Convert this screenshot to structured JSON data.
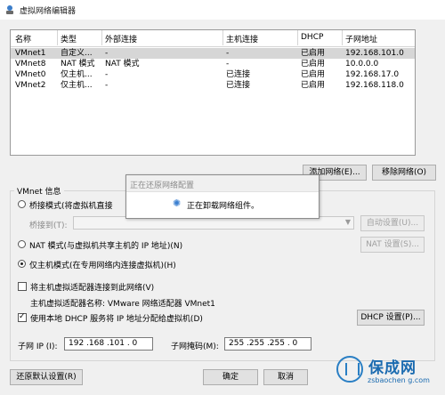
{
  "window": {
    "title": "虚拟网络编辑器",
    "icon": "vmware-network-icon"
  },
  "table": {
    "headers": [
      "名称",
      "类型",
      "外部连接",
      "主机连接",
      "DHCP",
      "子网地址"
    ],
    "rows": [
      [
        "VMnet1",
        "自定义...",
        "-",
        "-",
        "已启用",
        "192.168.101.0"
      ],
      [
        "VMnet8",
        "NAT 模式",
        "NAT 模式",
        "-",
        "已启用",
        "10.0.0.0"
      ],
      [
        "VMnet0",
        "仅主机...",
        "-",
        "已连接",
        "已启用",
        "192.168.17.0"
      ],
      [
        "VMnet2",
        "仅主机...",
        "-",
        "已连接",
        "已启用",
        "192.168.118.0"
      ]
    ],
    "selected_row": 0
  },
  "buttons": {
    "add_network": "添加网络(E)...",
    "remove_network": "移除网络(O)"
  },
  "vmnet_info": {
    "group_label": "VMnet 信息",
    "bridged_label": "桥接模式(将虚拟机直接",
    "bridged_to_label": "桥接到(T):",
    "auto_settings": "自动设置(U)...",
    "nat_label": "NAT 模式(与虚拟机共享主机的 IP 地址)(N)",
    "nat_settings": "NAT 设置(S)...",
    "hostonly_label": "仅主机模式(在专用网络内连接虚拟机)(H)",
    "connect_adapter_label": "将主机虚拟适配器连接到此网络(V)",
    "adapter_name_label": "主机虚拟适配器名称: VMware 网络适配器 VMnet1",
    "dhcp_label": "使用本地 DHCP 服务将 IP 地址分配给虚拟机(D)",
    "dhcp_settings": "DHCP 设置(P)...",
    "subnet_ip_label": "子网 IP (I):",
    "subnet_ip_value": "192 .168 .101 . 0",
    "subnet_mask_label": "子网掩码(M):",
    "subnet_mask_value": "255 .255 .255 . 0",
    "mode": "host-only",
    "connect_adapter_checked": false,
    "dhcp_checked": true
  },
  "footer": {
    "restore_defaults": "还原默认设置(R)",
    "ok": "确定",
    "cancel": "取消"
  },
  "dialog": {
    "title": "正在还原网络配置",
    "message": "正在卸载网络组件。"
  },
  "watermark": {
    "brand": "保成网",
    "url": "zsbaochen g.com"
  }
}
